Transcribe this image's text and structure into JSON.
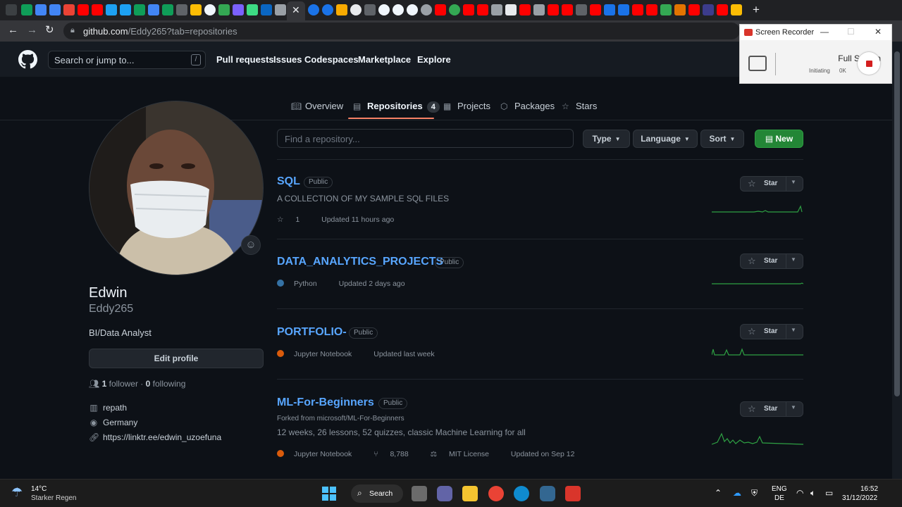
{
  "browser": {
    "url_host": "github.com",
    "url_path": "/Eddy265?tab=repositories",
    "tab_close": "✕",
    "new_tab": "+"
  },
  "header": {
    "search_placeholder": "Search or jump to...",
    "search_key": "/",
    "nav": [
      "Pull requests",
      "Issues",
      "Codespaces",
      "Marketplace",
      "Explore"
    ]
  },
  "profile_tabs": {
    "overview": "Overview",
    "repositories": "Repositories",
    "repositories_count": "4",
    "projects": "Projects",
    "packages": "Packages",
    "stars": "Stars"
  },
  "profile": {
    "name": "Edwin",
    "login": "Eddy265",
    "bio": "BI/Data Analyst",
    "edit_label": "Edit profile",
    "followers_count": "1",
    "followers_label": "follower",
    "following_count": "0",
    "following_label": "following",
    "company": "repath",
    "location": "Germany",
    "link": "https://linktr.ee/edwin_uzoefuna"
  },
  "repo_controls": {
    "find_placeholder": "Find a repository...",
    "type_label": "Type",
    "language_label": "Language",
    "sort_label": "Sort",
    "new_label": "New"
  },
  "repos": [
    {
      "name": "SQL",
      "visibility": "Public",
      "description": "A COLLECTION OF MY SAMPLE SQL FILES",
      "stars": "1",
      "updated": "Updated 11 hours ago",
      "star_label": "Star"
    },
    {
      "name": "DATA_ANALYTICS_PROJECTS",
      "visibility": "Public",
      "language": "Python",
      "language_color": "#3572A5",
      "updated": "Updated 2 days ago",
      "star_label": "Star"
    },
    {
      "name": "PORTFOLIO-",
      "visibility": "Public",
      "language": "Jupyter Notebook",
      "language_color": "#DA5B0B",
      "updated": "Updated last week",
      "star_label": "Star"
    },
    {
      "name": "ML-For-Beginners",
      "visibility": "Public",
      "forked_from": "Forked from microsoft/ML-For-Beginners",
      "description": "12 weeks, 26 lessons, 52 quizzes, classic Machine Learning for all",
      "language": "Jupyter Notebook",
      "language_color": "#DA5B0B",
      "forks": "8,788",
      "license": "MIT License",
      "updated": "Updated on Sep 12",
      "star_label": "Star"
    }
  ],
  "recorder": {
    "title": "Screen Recorder",
    "mode": "Full Screen",
    "status": "Initiating",
    "size": "0K"
  },
  "taskbar": {
    "temperature": "14°C",
    "weather": "Starker Regen",
    "search_label": "Search",
    "lang_top": "ENG",
    "lang_bottom": "DE",
    "time": "16:52",
    "date": "31/12/2022"
  },
  "colors": {
    "accent_green": "#238636",
    "link_blue": "#58a6ff",
    "tab_underline": "#f78166",
    "spark_green": "#2ea043"
  }
}
